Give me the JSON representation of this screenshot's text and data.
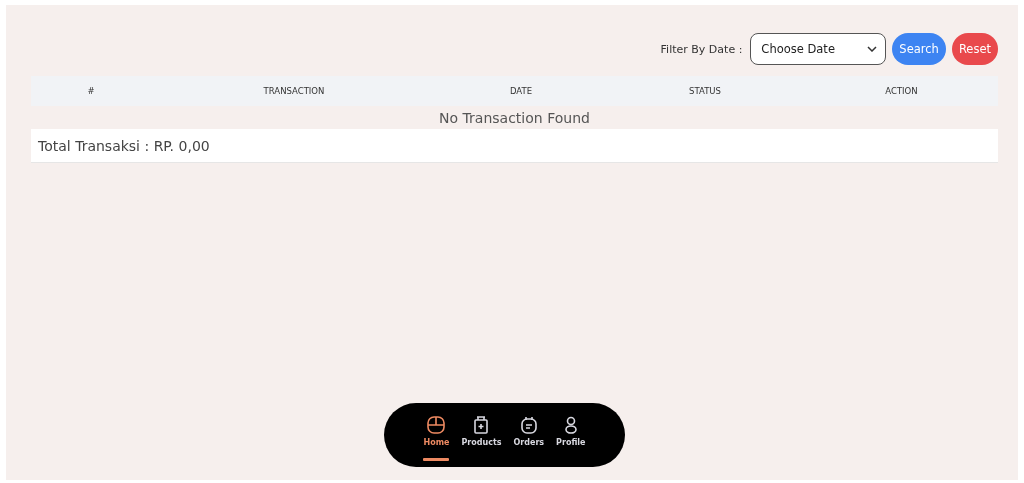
{
  "filter": {
    "label": "Filter By Date :",
    "select": {
      "value": "Choose Date"
    },
    "buttons": [
      {
        "label": "Search",
        "kind": "primary"
      },
      {
        "label": "Reset",
        "kind": "danger"
      }
    ]
  },
  "table": {
    "columns": [
      "#",
      "TRANSACTION",
      "DATE",
      "STATUS",
      "ACTION"
    ],
    "empty_message": "No Transaction Found",
    "total": "Total Transaksi : RP. 0,00"
  },
  "nav": [
    {
      "label": "Home",
      "kind": "home",
      "selected": true
    },
    {
      "label": "Products",
      "kind": "products",
      "selected": false
    },
    {
      "label": "Orders",
      "kind": "orders",
      "selected": false
    },
    {
      "label": "Profile",
      "kind": "profile",
      "selected": false
    }
  ]
}
